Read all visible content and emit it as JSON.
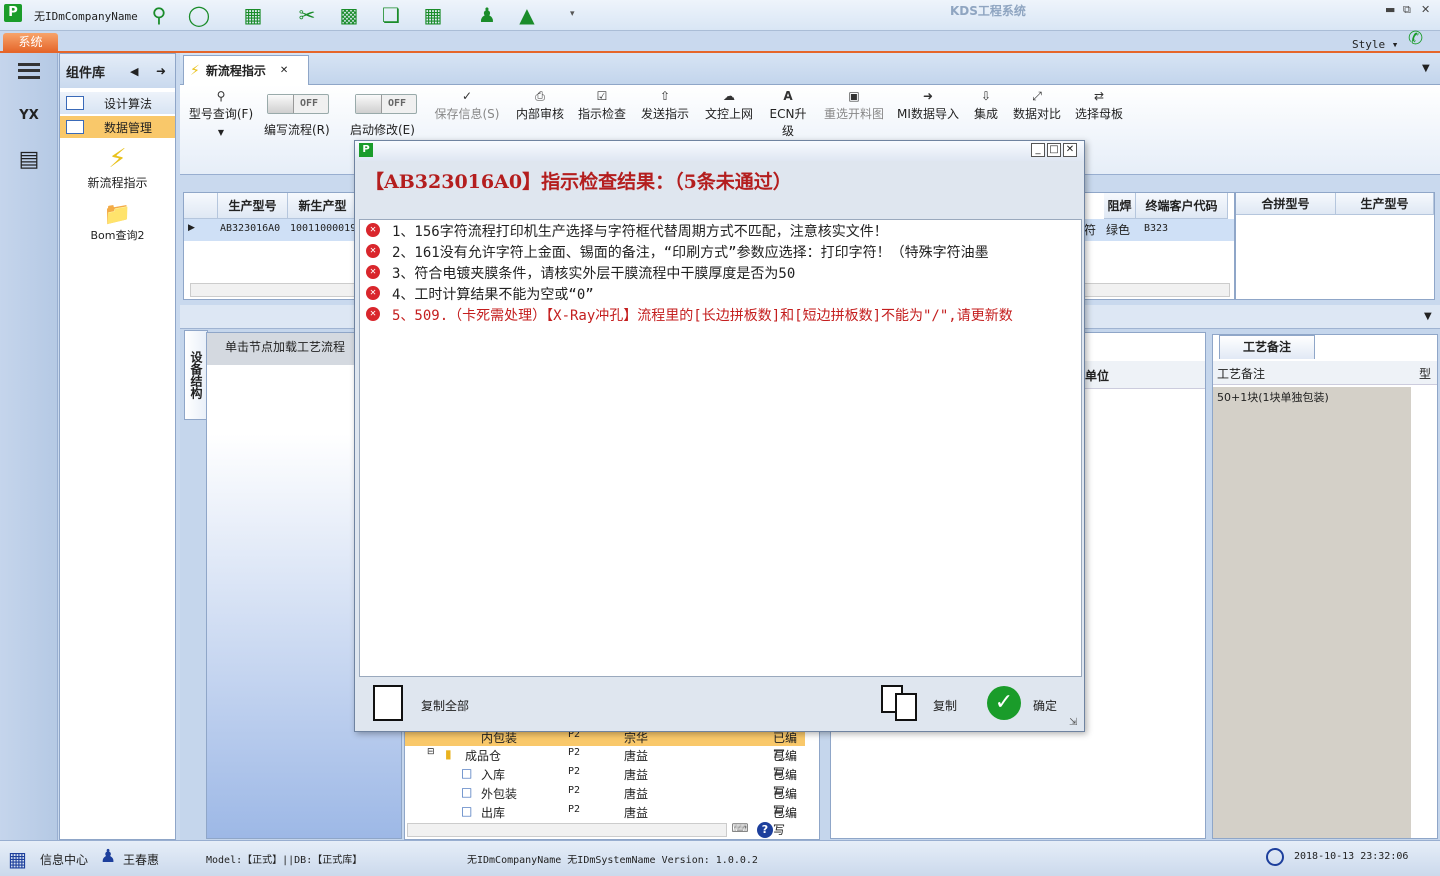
{
  "topbar": {
    "company": "无IDmCompanyName",
    "app_title": "KDS工程系统",
    "system_tab": "系统",
    "style_label": "Style"
  },
  "component_panel": {
    "title": "组件库",
    "items": [
      "设计算法",
      "数据管理"
    ],
    "tiles": [
      "新流程指示",
      "Bom查询2"
    ]
  },
  "tabs": {
    "active": "新流程指示"
  },
  "ribbon": {
    "model_query": "型号查询(F)",
    "toggle_off": "OFF",
    "edit_flow": "编写流程(R)",
    "start_modify": "启动修改(E)",
    "save_info": "保存信息(S)",
    "internal_review": "内部审核",
    "check_instruction": "指示检查",
    "send_instruction": "发送指示",
    "doc_upload": "文控上网",
    "ecn_upgrade": "ECN升级",
    "reselect_drawing": "重选开料图",
    "mi_import": "MI数据导入",
    "integrate": "集成",
    "data_compare": "数据对比",
    "select_mother": "选择母板"
  },
  "grid": {
    "headers": [
      "生产型号",
      "新生产型",
      "阻焊",
      "终端客户代码",
      "合拼型号",
      "生产型号"
    ],
    "row": {
      "model": "AB323016A0",
      "new_model": "10011000019",
      "partial": "符",
      "solder": "绿色",
      "customer": "B323"
    }
  },
  "lower": {
    "vtab": "设备结构",
    "hint": "单击节点加载工艺流程",
    "unit_header": "单位",
    "craft_tab": "工艺备注",
    "craft_header": "工艺备注",
    "type_header": "型",
    "craft_note": "50+1块(1块单独包装)"
  },
  "tree": [
    {
      "name": "内包装",
      "code": "P2",
      "owner": "宗华",
      "status": "已编写"
    },
    {
      "name": "成品仓",
      "code": "P2",
      "owner": "唐益",
      "status": "已编写"
    },
    {
      "name": "入库",
      "code": "P2",
      "owner": "唐益",
      "status": "已编写"
    },
    {
      "name": "外包装",
      "code": "P2",
      "owner": "唐益",
      "status": "已编写"
    },
    {
      "name": "出库",
      "code": "P2",
      "owner": "唐益",
      "status": "已编写"
    }
  ],
  "dialog": {
    "heading": "【AB323016A0】指示检查结果：（5条未通过）",
    "messages": [
      "1、156字符流程打印机生产选择与字符框代替周期方式不匹配，注意核实文件！",
      "2、161没有允许字符上金面、锡面的备注，“印刷方式”参数应选择：打印字符！（特殊字符油墨",
      "3、符合电镀夹膜条件，请核实外层干膜流程中干膜厚度是否为50",
      "4、工时计算结果不能为空或“0”",
      "5、509.（卡死需处理）【X-Ray冲孔】流程里的[长边拼板数]和[短边拼板数]不能为\"/\",请更新数"
    ],
    "copy_all": "复制全部",
    "copy": "复制",
    "ok": "确定"
  },
  "status": {
    "info_center": "信息中心",
    "user": "王春惠",
    "model": "Model:【正式】||DB:【正式库】",
    "system": "无IDmCompanyName 无IDmSystemName  Version: 1.0.0.2",
    "datetime": "2018-10-13 23:32:06"
  },
  "colors": {
    "accent_orange": "#e5662a",
    "error_red": "#d9262c",
    "heading_red": "#b41e1e",
    "ok_green": "#1a9c2a"
  }
}
